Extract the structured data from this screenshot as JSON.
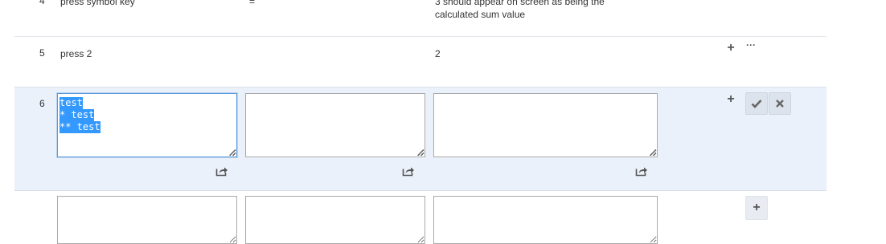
{
  "rows": [
    {
      "number": "4",
      "action": "press symbol key",
      "data": "=",
      "expected": "3 should appear on screen as being the calculated sum value"
    },
    {
      "number": "5",
      "action": "press 2",
      "data": "",
      "expected": "2"
    }
  ],
  "editing_row": {
    "number": "6",
    "action_lines": [
      "test",
      "* test",
      "** test"
    ],
    "data_value": "",
    "expected_value": ""
  },
  "new_row": {
    "action_value": "",
    "data_value": "",
    "expected_value": ""
  },
  "icons": {
    "add_step": "plus-icon",
    "more": "ellipsis-icon",
    "confirm": "checkmark-icon",
    "cancel": "x-icon",
    "share": "share-icon"
  },
  "colors": {
    "editing_row_bg": "#eaf1fb",
    "selection": "#3399ff",
    "focus_border": "#5b9ad8"
  }
}
